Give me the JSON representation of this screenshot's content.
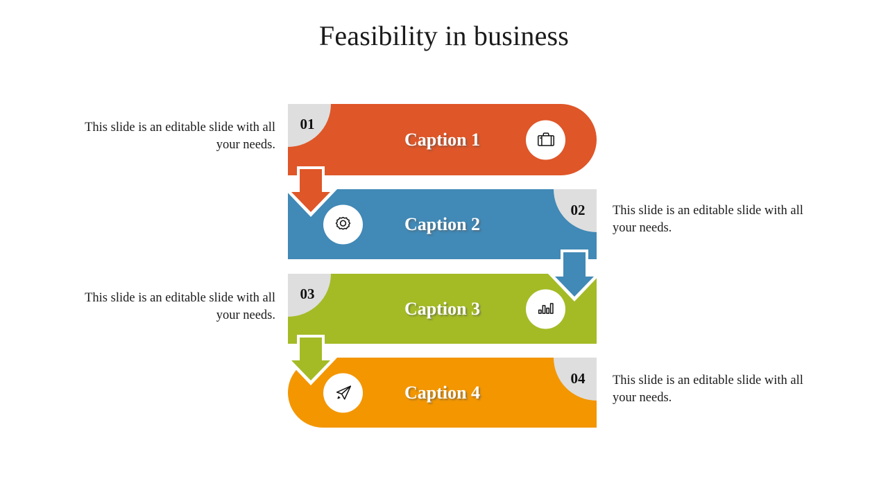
{
  "slide": {
    "title": "Feasibility in business",
    "background": "#ffffff"
  },
  "colors": {
    "row1": "#df5628",
    "row2": "#4189b6",
    "row3": "#a4bb26",
    "row4": "#f39600",
    "badge": "#dedede",
    "caption_text": "#ffffff",
    "body_text": "#1b1b1b"
  },
  "rows": [
    {
      "number": "01",
      "caption": "Caption 1",
      "icon": "briefcase-icon",
      "color": "#df5628",
      "badge_side": "left",
      "icon_side": "right",
      "description": "This slide is an editable slide with all your needs.",
      "description_side": "left"
    },
    {
      "number": "02",
      "caption": "Caption 2",
      "icon": "gear-icon",
      "color": "#4189b6",
      "badge_side": "right",
      "icon_side": "left",
      "description": "This slide is an editable slide with all your needs.",
      "description_side": "right"
    },
    {
      "number": "03",
      "caption": "Caption 3",
      "icon": "bar-chart-icon",
      "color": "#a4bb26",
      "badge_side": "left",
      "icon_side": "right",
      "description": "This slide is an editable slide with all your needs.",
      "description_side": "left"
    },
    {
      "number": "04",
      "caption": "Caption 4",
      "icon": "paper-plane-icon",
      "color": "#f39600",
      "badge_side": "right",
      "icon_side": "left",
      "description": "This slide is an editable slide with all your needs.",
      "description_side": "right"
    }
  ],
  "connectors": [
    {
      "from": "01",
      "to": "02",
      "color": "#df5628",
      "direction": "down"
    },
    {
      "from": "02",
      "to": "03",
      "color": "#4189b6",
      "direction": "down"
    },
    {
      "from": "03",
      "to": "04",
      "color": "#a4bb26",
      "direction": "down"
    }
  ]
}
